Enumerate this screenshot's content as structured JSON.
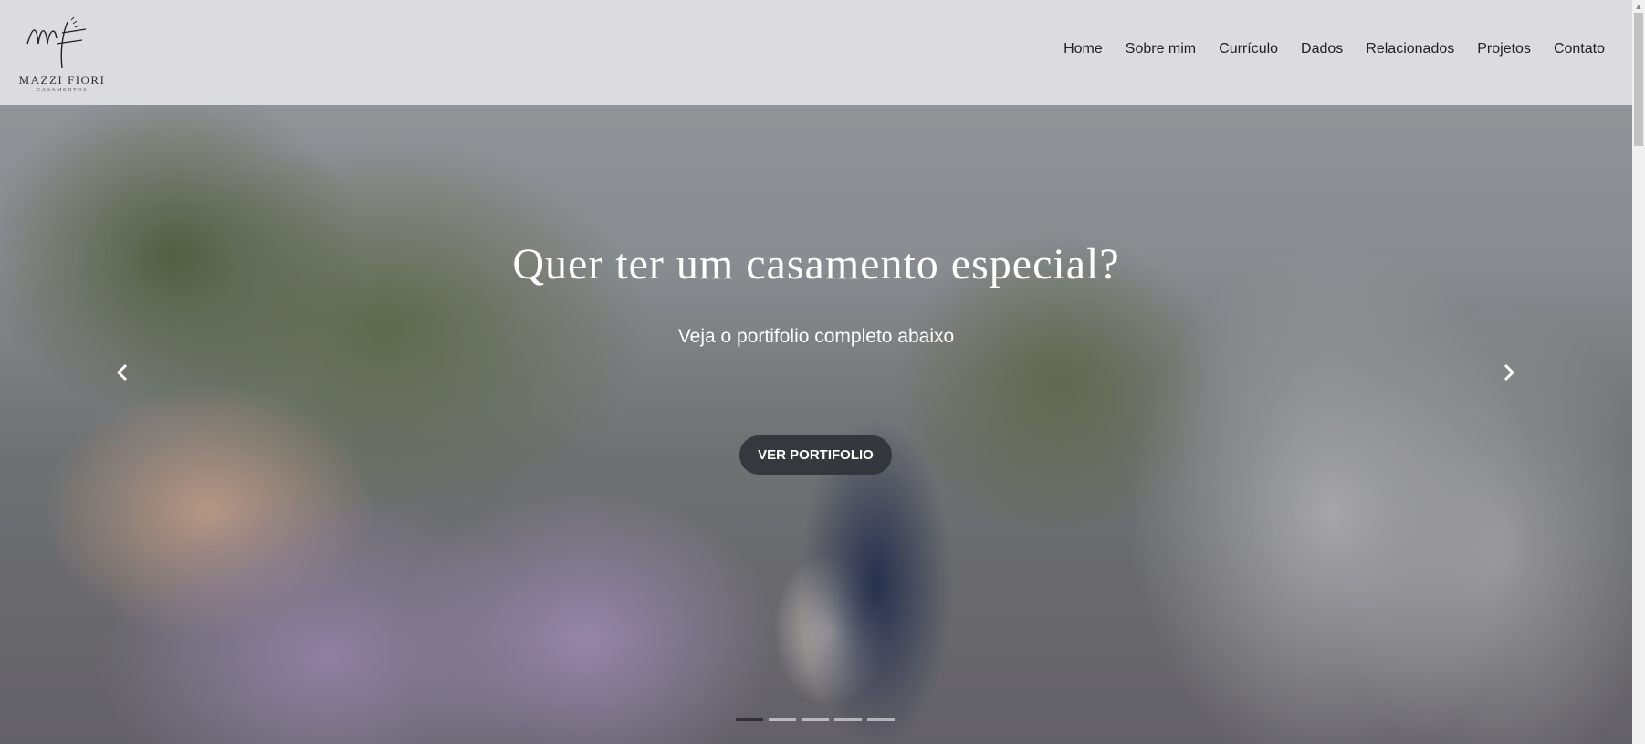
{
  "brand": {
    "name": "MAZZI FIORI",
    "subtitle": "CASAMENTOS"
  },
  "nav": {
    "items": [
      "Home",
      "Sobre mim",
      "Currículo",
      "Dados",
      "Relacionados",
      "Projetos",
      "Contato"
    ]
  },
  "hero": {
    "title": "Quer ter um casamento especial?",
    "subtitle": "Veja o portifolio completo abaixo",
    "cta_label": "VER PORTIFOLIO",
    "slides_count": 5,
    "active_slide": 1,
    "prev_icon": "chevron-left-icon",
    "next_icon": "chevron-right-icon"
  },
  "colors": {
    "header_bg": "#e8e8ea",
    "cta_bg": "#30343a",
    "text_light": "#ffffff"
  }
}
